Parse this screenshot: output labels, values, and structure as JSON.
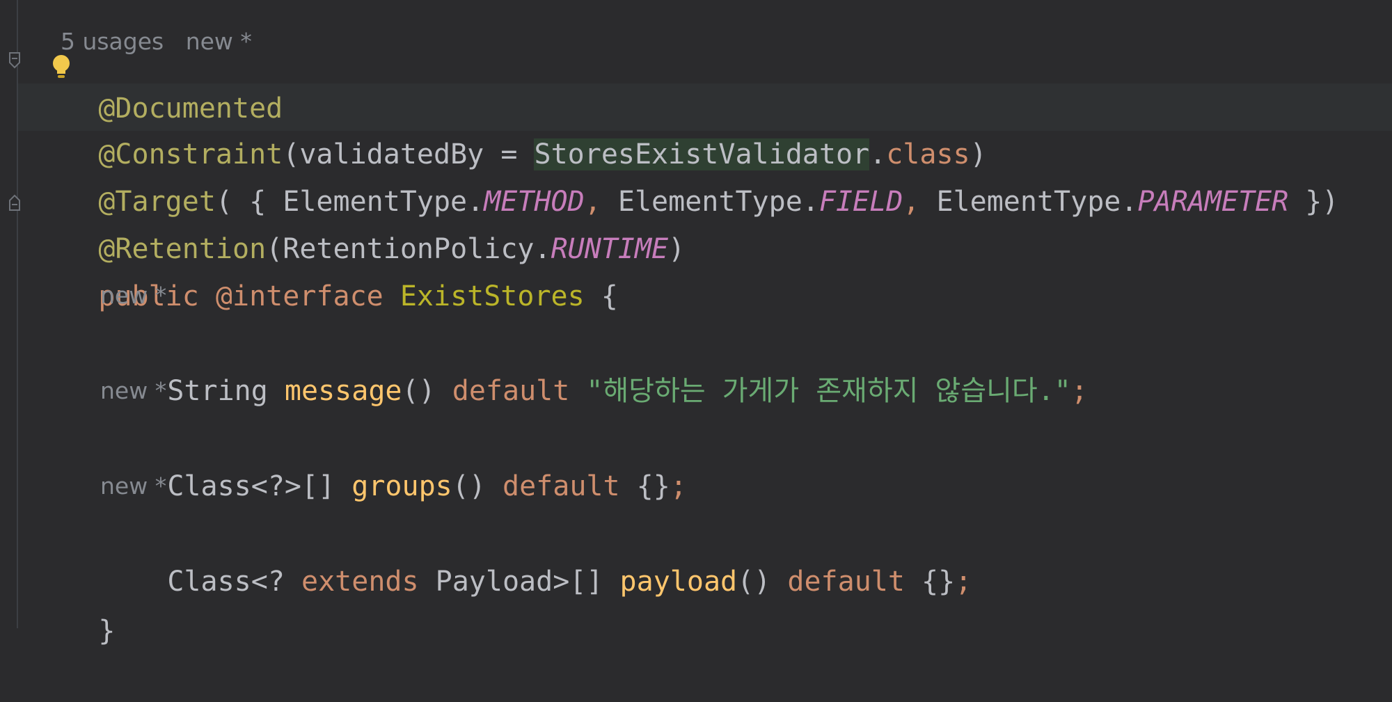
{
  "inlay": {
    "usages": "5 usages",
    "new_star": "new *"
  },
  "code": {
    "line1": {
      "at_documented": "@Documented"
    },
    "line2": {
      "annotation": "@Constraint",
      "open": "(",
      "param": "validatedBy = ",
      "validator": "StoresExistValidator",
      "dot": ".",
      "class_kw": "class",
      "close": ")"
    },
    "line3": {
      "annotation": "@Target",
      "open": "( { ",
      "et1": "ElementType.",
      "c1": "METHOD",
      "sep1": ", ",
      "et2": "ElementType.",
      "c2": "FIELD",
      "sep2": ", ",
      "et3": "ElementType.",
      "c3": "PARAMETER",
      "close": " })"
    },
    "line4": {
      "annotation": "@Retention",
      "open": "(",
      "policy": "RetentionPolicy.",
      "const": "RUNTIME",
      "close": ")"
    },
    "line5": {
      "public": "public",
      "at_interface": " @interface",
      "name": " ExistStores",
      "brace": " {"
    },
    "line6": {
      "type": "String ",
      "method": "message",
      "parens": "() ",
      "default": "default ",
      "string": "\"해당하는 가게가 존재하지 않습니다.\"",
      "semi": ";"
    },
    "line7": {
      "type": "Class<?>[] ",
      "method": "groups",
      "parens": "() ",
      "default": "default ",
      "braces": "{}",
      "semi": ";"
    },
    "line8": {
      "type1": "Class<? ",
      "extends": "extends",
      "type2": " Payload>[] ",
      "method": "payload",
      "parens": "() ",
      "default": "default ",
      "braces": "{}",
      "semi": ";"
    },
    "line9": {
      "brace": "}"
    }
  },
  "colors": {
    "background": "#2b2b2d",
    "annotation": "#b3ae60",
    "keyword": "#cf8e6d",
    "method": "#ffc66d",
    "constant": "#c77dbb",
    "string": "#6aab73",
    "hint": "#868a91"
  },
  "icons": [
    "fold-icon",
    "lightbulb-icon"
  ]
}
